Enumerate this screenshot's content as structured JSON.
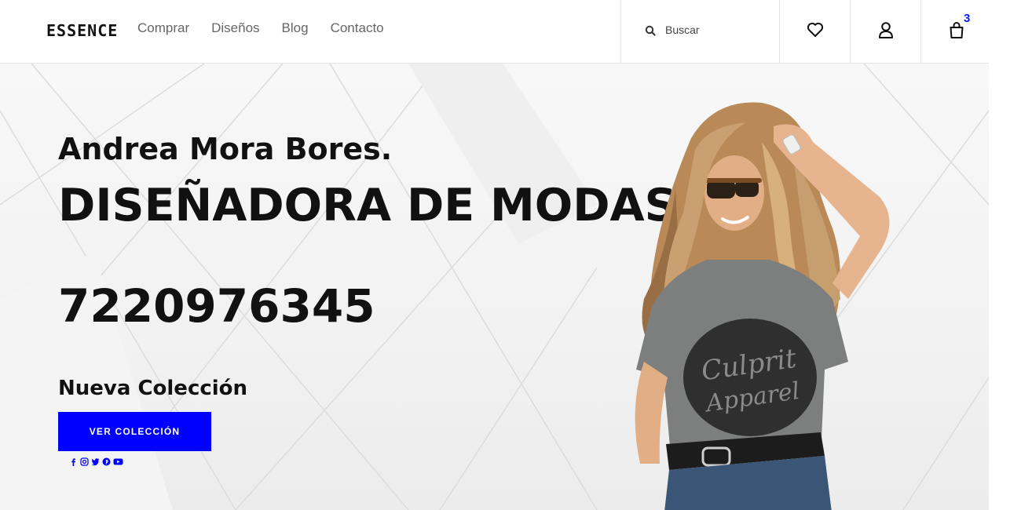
{
  "header": {
    "logo": "ESSENCE",
    "nav": [
      "Comprar",
      "Diseños",
      "Blog",
      "Contacto"
    ],
    "search_placeholder": "Buscar",
    "icons": [
      "search-icon",
      "heart-icon",
      "user-icon",
      "shopping-bag-icon"
    ],
    "cart_count": "3"
  },
  "hero": {
    "name": "Andrea Mora Bores.",
    "role": "DISEÑADORA DE MODAS",
    "phone": "7220976345",
    "tagline": "Nueva Colección",
    "button_label": "VER COLECCIÓN",
    "button_color": "#0000ff",
    "social_icons": [
      "facebook-icon",
      "instagram-icon",
      "twitter-icon",
      "pinterest-icon",
      "youtube-icon"
    ],
    "image_description_shirt_text": "Culprit Apparel"
  }
}
